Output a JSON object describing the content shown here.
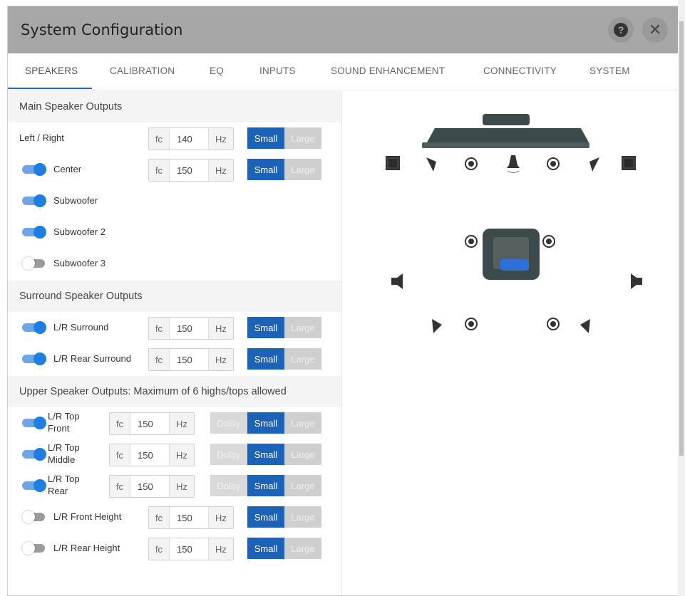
{
  "window": {
    "title": "System Configuration"
  },
  "tabs": [
    {
      "label": "SPEAKERS"
    },
    {
      "label": "CALIBRATION"
    },
    {
      "label": "EQ"
    },
    {
      "label": "INPUTS"
    },
    {
      "label": "SOUND ENHANCEMENT"
    },
    {
      "label": "CONNECTIVITY"
    },
    {
      "label": "SYSTEM"
    }
  ],
  "common": {
    "fc": "fc",
    "hz": "Hz",
    "small": "Small",
    "large": "Large",
    "dolby": "Dolby"
  },
  "main": {
    "heading": "Main Speaker Outputs",
    "rows": [
      {
        "label": "Left / Right",
        "value": "140"
      },
      {
        "label": "Center",
        "value": "150",
        "enabled": true
      },
      {
        "label": "Subwoofer",
        "enabled": true
      },
      {
        "label": "Subwoofer 2",
        "enabled": true
      },
      {
        "label": "Subwoofer 3",
        "enabled": false
      }
    ]
  },
  "surround": {
    "heading": "Surround Speaker Outputs",
    "rows": [
      {
        "label": "L/R Surround",
        "value": "150",
        "enabled": true
      },
      {
        "label": "L/R Rear Surround",
        "value": "150",
        "enabled": true
      }
    ]
  },
  "upper": {
    "heading": "Upper Speaker Outputs: Maximum of 6 highs/tops allowed",
    "rows": [
      {
        "label1": "L/R Top",
        "label2": "Front",
        "value": "150",
        "enabled": true
      },
      {
        "label1": "L/R Top",
        "label2": "Middle",
        "value": "150",
        "enabled": true
      },
      {
        "label1": "L/R Top",
        "label2": "Rear",
        "value": "150",
        "enabled": true
      },
      {
        "label": "L/R Front Height",
        "value": "150",
        "enabled": false
      },
      {
        "label": "L/R Rear Height",
        "value": "150",
        "enabled": false
      }
    ]
  },
  "colors": {
    "accent": "#1a63b8",
    "toggle_on": "#1f7fe0",
    "titlebar": "#a7a7a7"
  },
  "icons": [
    "help-icon",
    "close-icon",
    "tv-icon",
    "speaker-icon",
    "seat-icon"
  ]
}
